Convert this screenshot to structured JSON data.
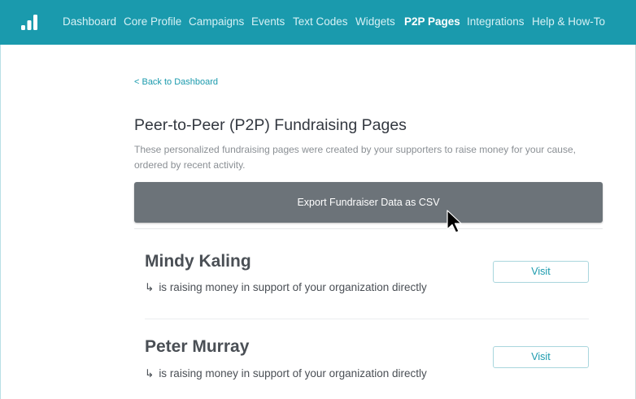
{
  "nav": {
    "logo_icon": "bar-chart-logo-icon",
    "items": [
      {
        "label": "Dashboard",
        "active": false
      },
      {
        "label": "Core Profile",
        "active": false
      },
      {
        "label": "Campaigns",
        "active": false
      },
      {
        "label": "Events",
        "active": false
      },
      {
        "label": "Text Codes",
        "active": false
      },
      {
        "label": "Widgets",
        "active": false
      },
      {
        "label": "P2P Pages",
        "active": true
      },
      {
        "label": "Integrations",
        "active": false
      },
      {
        "label": "Help & How-To",
        "active": false
      }
    ]
  },
  "main": {
    "back_link": "< Back to Dashboard",
    "title": "Peer-to-Peer (P2P) Fundraising Pages",
    "description": "These personalized fundraising pages were created by your supporters to raise money for your cause, ordered by recent activity.",
    "export_button": "Export Fundraiser Data as CSV",
    "fundraisers": [
      {
        "name": "Mindy Kaling",
        "arrow": "↳",
        "subtitle": "is raising money in support of your organization directly",
        "visit_label": "Visit"
      },
      {
        "name": "Peter Murray",
        "arrow": "↳",
        "subtitle": "is raising money in support of your organization directly",
        "visit_label": "Visit"
      }
    ]
  },
  "colors": {
    "nav_background": "#1a9aad",
    "accent": "#1a9aad",
    "export_button_bg": "#6c7379",
    "text_dark": "#333840",
    "text_muted": "#8a8f94"
  },
  "cursor_icon": "mouse-pointer-icon"
}
